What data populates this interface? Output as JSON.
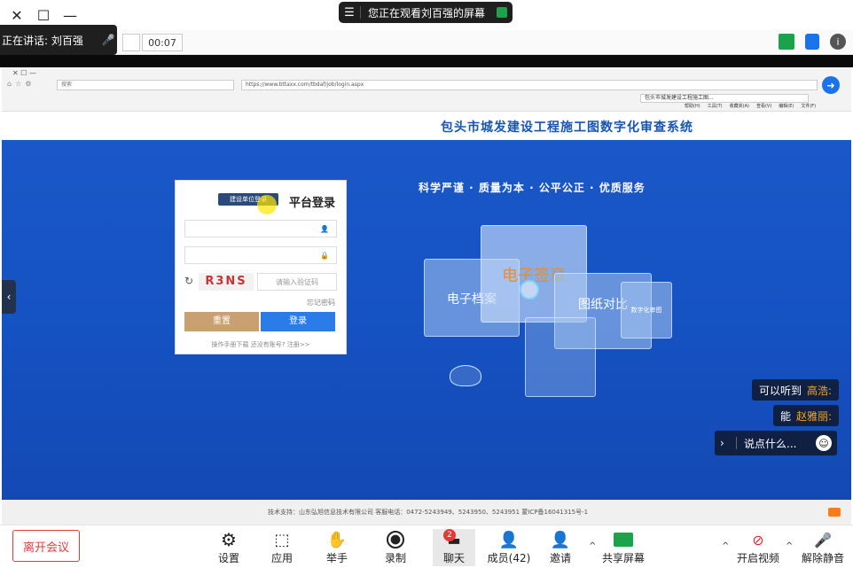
{
  "window": {
    "banner_text": "您正在观看刘百强的屏幕",
    "timer": "00:07",
    "speaking_label": "正在讲话: 刘百强"
  },
  "browser": {
    "url": "https://www.bttaxx.com/tbdaf/job/login.aspx",
    "tab_title": "包头市城发建设工程施工图...",
    "search_placeholder": "搜索",
    "menu": [
      "文件(F)",
      "编辑(E)",
      "查看(V)",
      "收藏夹(A)",
      "工具(T)",
      "帮助(H)"
    ]
  },
  "site": {
    "title": "包头市城发建设工程施工图数字化审查系统",
    "slogan": "科学严谨 · 质量为本 · 公平公正 · 优质服务",
    "cards": [
      "电子签章",
      "电子档案",
      "图纸对比",
      "数字化审图"
    ],
    "footer": "技术支持：山东弘旭信息技术有限公司  客服电话：0472-5243949、5243950、5243951  蒙ICP备16041315号-1"
  },
  "login": {
    "title": "平台登录",
    "tag": "建设单位登录",
    "username_placeholder": "",
    "password_placeholder": "",
    "captcha_placeholder": "请输入验证码",
    "captcha_code": "R3NS",
    "forgot": "忘记密码",
    "login_button": "登录",
    "reset_button": "重置",
    "links": "操作手册下载   还没有账号? 注册>>"
  },
  "chat": [
    {
      "name": "高浩:",
      "message": "可以听到"
    },
    {
      "name": "赵雅丽:",
      "message": "能"
    }
  ],
  "chat_input": {
    "placeholder": "说点什么..."
  },
  "bottom": {
    "leave": "离开会议",
    "buttons": [
      {
        "label": "设置",
        "icon": "gear-icon"
      },
      {
        "label": "应用",
        "icon": "apps-icon"
      },
      {
        "label": "举手",
        "icon": "hand-icon"
      },
      {
        "label": "录制",
        "icon": "record-icon"
      },
      {
        "label": "聊天",
        "icon": "chat-icon",
        "badge": "2"
      },
      {
        "label": "成员(42)",
        "icon": "members-icon"
      },
      {
        "label": "邀请",
        "icon": "invite-icon"
      },
      {
        "label": "共享屏幕",
        "icon": "share-screen-icon"
      },
      {
        "label": "开启视频",
        "icon": "video-off-icon"
      },
      {
        "label": "解除静音",
        "icon": "mic-off-icon"
      }
    ]
  },
  "colors": {
    "meeting_accent": "#e03c3c",
    "site_blue": "#1655b0",
    "share_green": "#1aa34a",
    "badge_red": "#e53935"
  }
}
